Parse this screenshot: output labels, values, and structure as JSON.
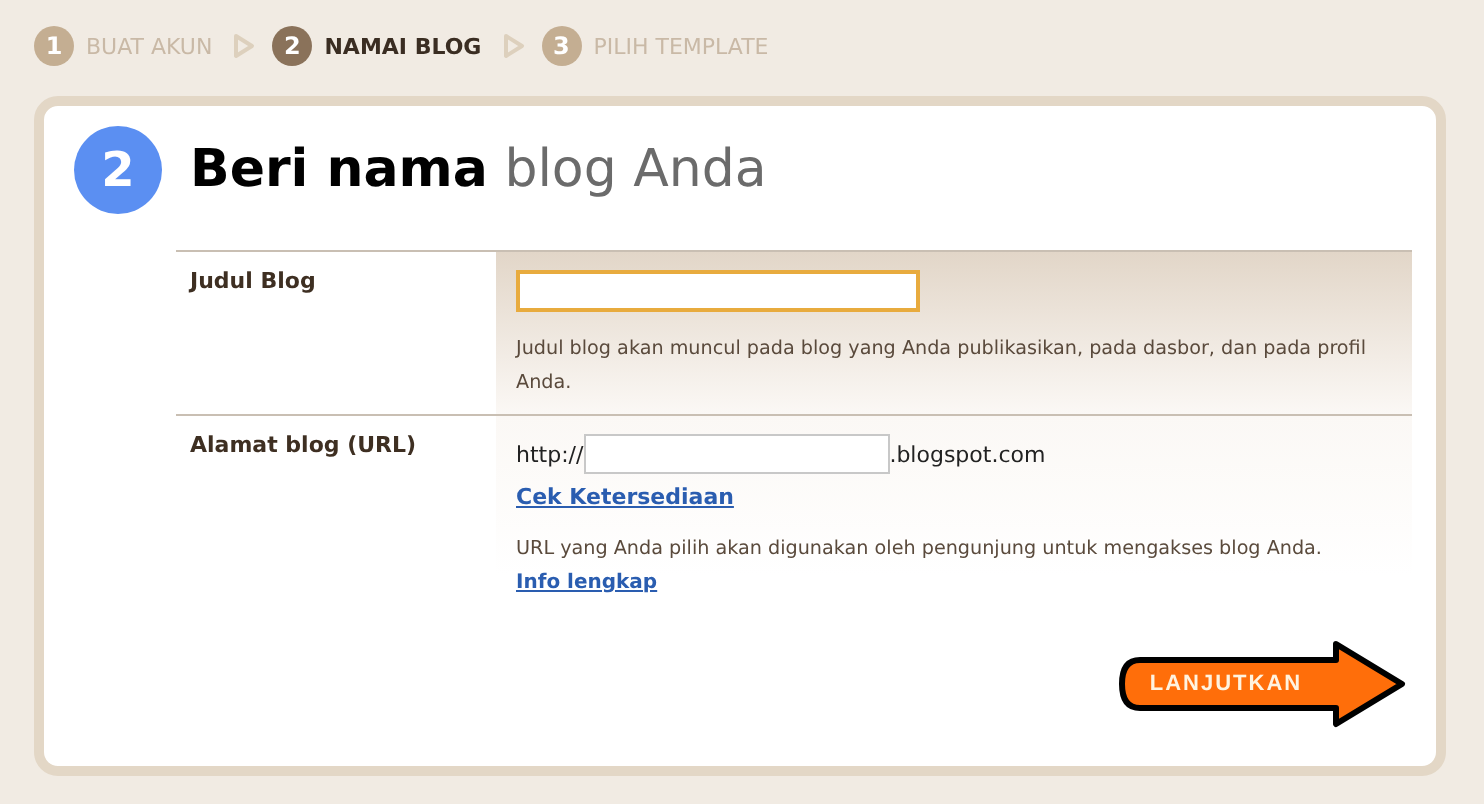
{
  "steps": [
    {
      "number": "1",
      "label": "BUAT AKUN",
      "selected": false
    },
    {
      "number": "2",
      "label": "NAMAI BLOG",
      "selected": true
    },
    {
      "number": "3",
      "label": "PILIH TEMPLATE",
      "selected": false
    }
  ],
  "header": {
    "number": "2",
    "title_bold": "Beri nama",
    "title_rest": "blog Anda"
  },
  "form": {
    "rows": [
      {
        "kind": "title",
        "label": "Judul Blog",
        "focused": true,
        "hint": "Judul blog akan muncul pada blog yang Anda publikasikan, pada dasbor, dan pada profil Anda."
      },
      {
        "kind": "url",
        "label": "Alamat blog (URL)",
        "focused": false,
        "prefix": "http://",
        "suffix": ".blogspot.com",
        "check_link": "Cek Ketersediaan",
        "hint": "URL yang Anda pilih akan digunakan oleh pengunjung untuk mengakses blog Anda.",
        "info_link": "Info lengkap"
      }
    ]
  },
  "continue_button": "LANJUTKAN"
}
